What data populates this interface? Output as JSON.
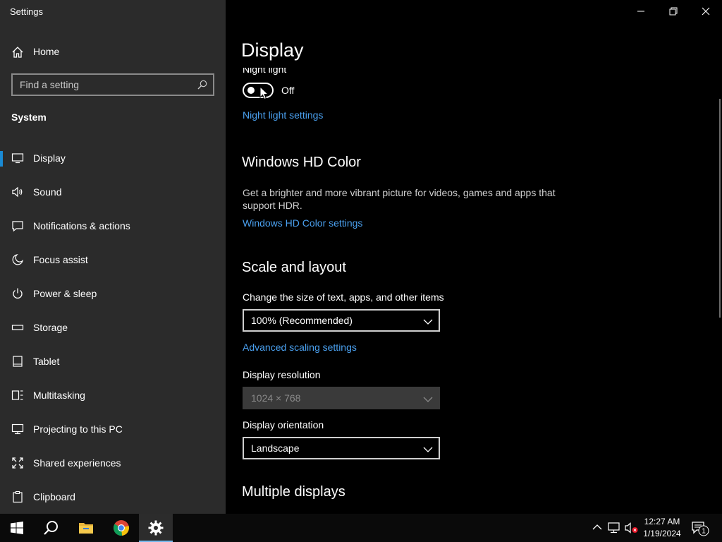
{
  "app": {
    "title": "Settings"
  },
  "sidebar": {
    "home": "Home",
    "search_placeholder": "Find a setting",
    "section": "System",
    "items": [
      {
        "label": "Display",
        "icon": "monitor-icon",
        "active": true
      },
      {
        "label": "Sound",
        "icon": "speaker-icon"
      },
      {
        "label": "Notifications & actions",
        "icon": "message-icon"
      },
      {
        "label": "Focus assist",
        "icon": "moon-icon"
      },
      {
        "label": "Power & sleep",
        "icon": "power-icon"
      },
      {
        "label": "Storage",
        "icon": "drive-icon"
      },
      {
        "label": "Tablet",
        "icon": "tablet-icon"
      },
      {
        "label": "Multitasking",
        "icon": "multitasking-icon"
      },
      {
        "label": "Projecting to this PC",
        "icon": "projecting-icon"
      },
      {
        "label": "Shared experiences",
        "icon": "shared-icon"
      },
      {
        "label": "Clipboard",
        "icon": "clipboard-icon"
      }
    ]
  },
  "main": {
    "title": "Display",
    "night_light": {
      "label": "Night light",
      "state": "Off",
      "link": "Night light settings"
    },
    "hdr": {
      "heading": "Windows HD Color",
      "description": "Get a brighter and more vibrant picture for videos, games and apps that support HDR.",
      "link": "Windows HD Color settings"
    },
    "scale": {
      "heading": "Scale and layout",
      "size_label": "Change the size of text, apps, and other items",
      "size_value": "100% (Recommended)",
      "advanced_link": "Advanced scaling settings",
      "resolution_label": "Display resolution",
      "resolution_value": "1024 × 768",
      "orientation_label": "Display orientation",
      "orientation_value": "Landscape"
    },
    "multiple_displays": {
      "heading": "Multiple displays"
    }
  },
  "taskbar": {
    "time": "12:27 AM",
    "date": "1/19/2024",
    "notification_count": "1"
  },
  "colors": {
    "accent": "#1a8ad4",
    "link": "#4aa0ef",
    "sidebar_bg": "#2b2b2b"
  }
}
